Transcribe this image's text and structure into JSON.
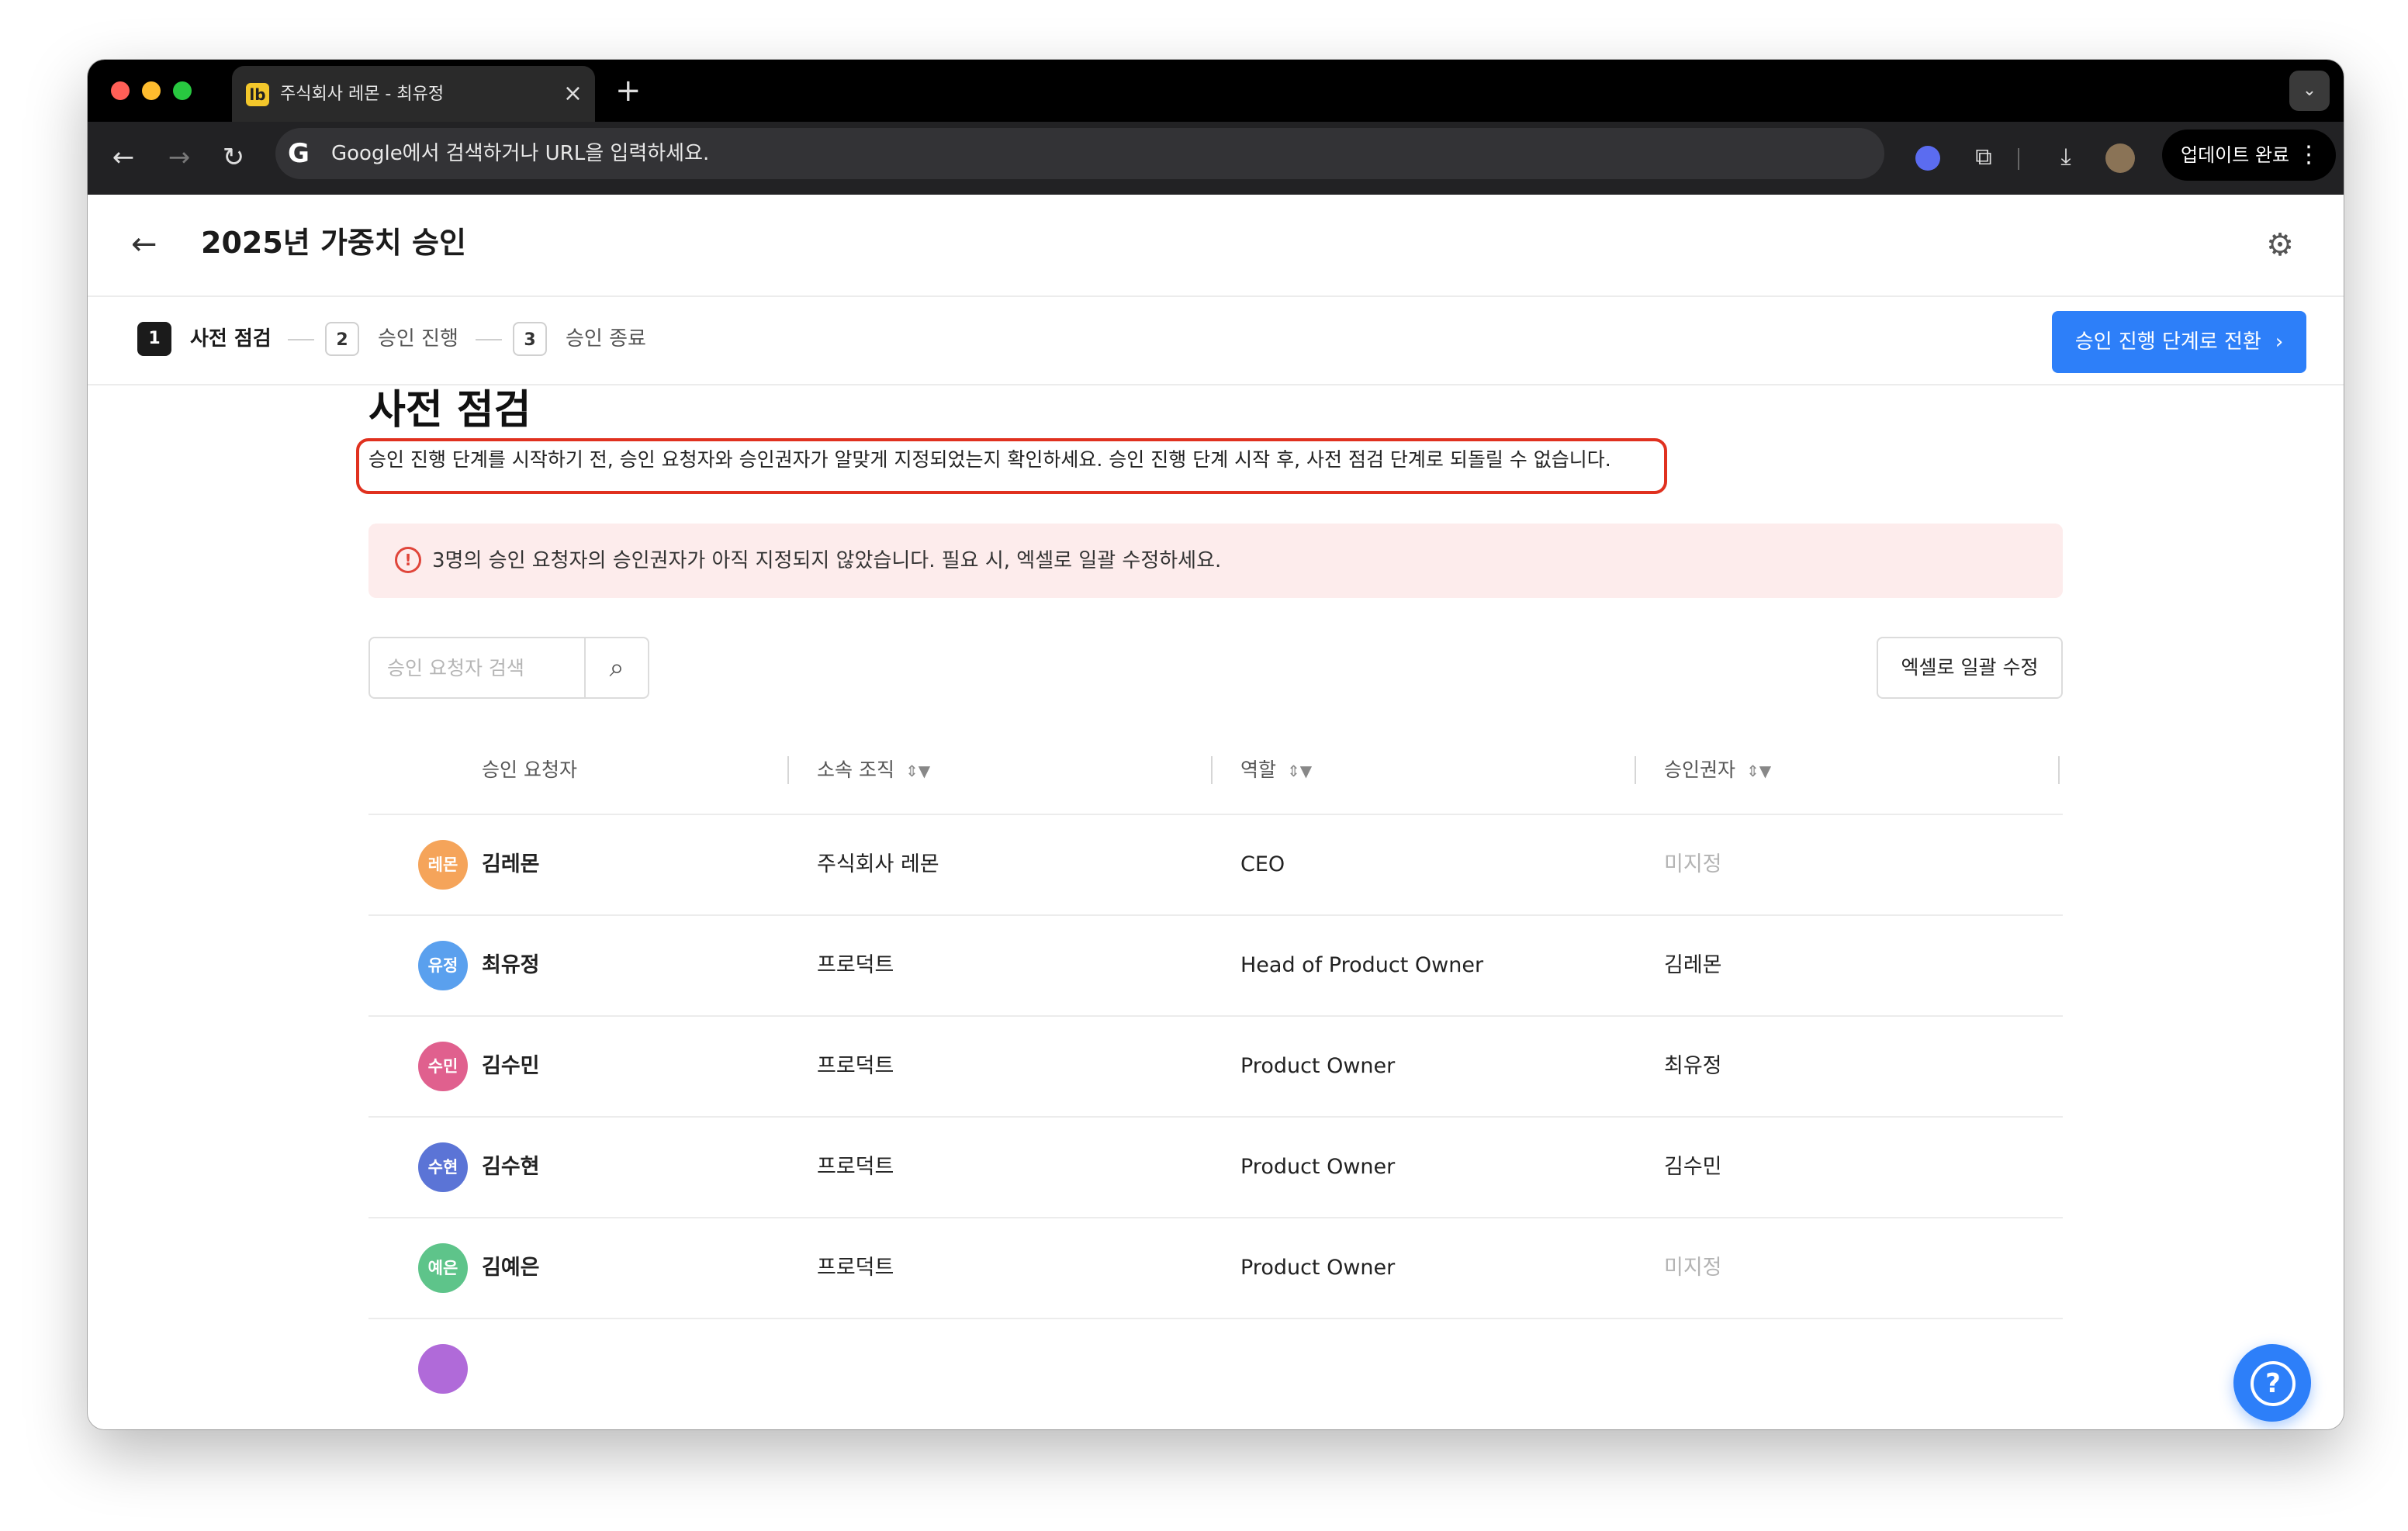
{
  "browser": {
    "tab_favicon": "lb",
    "tab_title": "주식회사 레몬 - 최유정",
    "omnibox_placeholder": "Google에서 검색하거나 URL을 입력하세요.",
    "update_label": "업데이트 완료"
  },
  "page": {
    "title": "2025년 가중치 승인"
  },
  "steps": [
    {
      "num": "1",
      "label": "사전 점검"
    },
    {
      "num": "2",
      "label": "승인 진행"
    },
    {
      "num": "3",
      "label": "승인 종료"
    }
  ],
  "primary_button": "승인 진행 단계로 전환",
  "section": {
    "title": "사전 점검",
    "description": "승인 진행 단계를 시작하기 전, 승인 요청자와 승인권자가 알맞게 지정되었는지 확인하세요. 승인 진행 단계 시작 후, 사전 점검 단계로 되돌릴 수 없습니다."
  },
  "alert": {
    "icon": "!",
    "text": "3명의 승인 요청자의 승인권자가 아직 지정되지 않았습니다. 필요 시, 엑셀로 일괄 수정하세요."
  },
  "search": {
    "placeholder": "승인 요청자 검색"
  },
  "excel_button": "엑셀로 일괄 수정",
  "table": {
    "headers": [
      "승인 요청자",
      "소속 조직",
      "역할",
      "승인권자"
    ],
    "rows": [
      {
        "avatar": "레몬",
        "avatar_color": "#f5a45a",
        "name": "김레몬",
        "org": "주식회사 레몬",
        "role": "CEO",
        "approver": "미지정"
      },
      {
        "avatar": "유정",
        "avatar_color": "#5aa0ee",
        "name": "최유정",
        "org": "프로덕트",
        "role": "Head of Product Owner",
        "approver": "김레몬"
      },
      {
        "avatar": "수민",
        "avatar_color": "#e0608e",
        "name": "김수민",
        "org": "프로덕트",
        "role": "Product Owner",
        "approver": "최유정"
      },
      {
        "avatar": "수현",
        "avatar_color": "#5b74d6",
        "name": "김수현",
        "org": "프로덕트",
        "role": "Product Owner",
        "approver": "김수민"
      },
      {
        "avatar": "예은",
        "avatar_color": "#5ec48a",
        "name": "김예은",
        "org": "프로덕트",
        "role": "Product Owner",
        "approver": "미지정"
      },
      {
        "avatar": "",
        "avatar_color": "#b06ad9",
        "name": "",
        "org": "",
        "role": "",
        "approver": ""
      }
    ]
  },
  "help_icon": "?"
}
